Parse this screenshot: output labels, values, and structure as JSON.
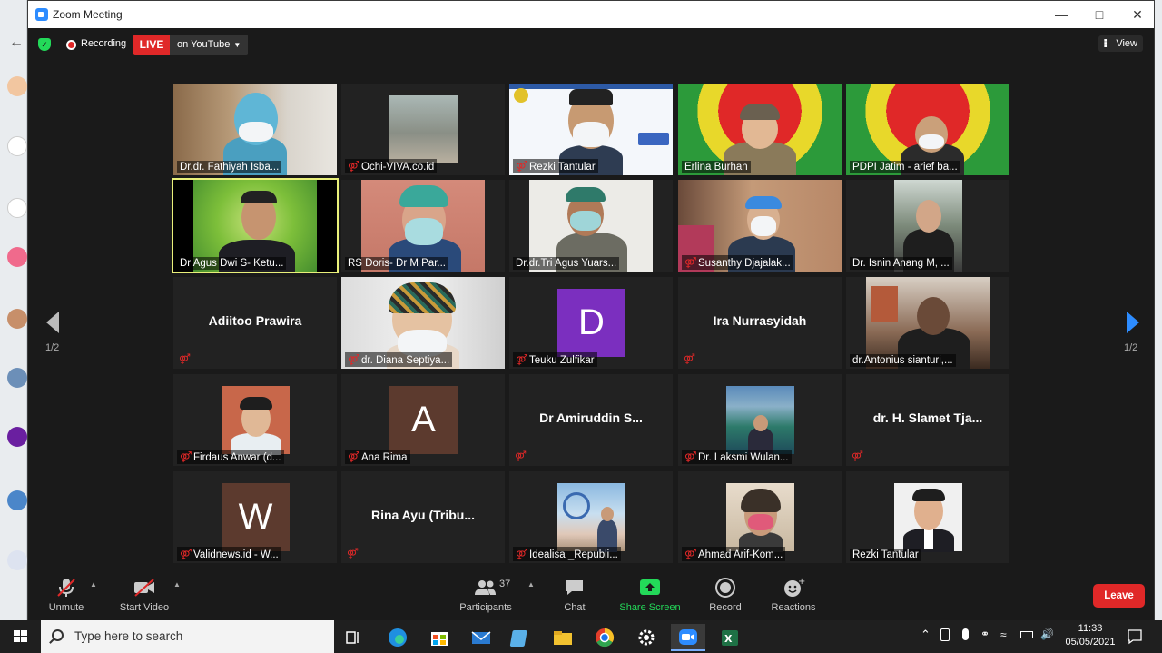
{
  "window": {
    "title": "Zoom Meeting"
  },
  "topbar": {
    "recording_label": "Recording",
    "live_label": "LIVE",
    "stream_target": "on YouTube",
    "view_label": "View"
  },
  "colors": {
    "accent": "#2d8cff",
    "live_red": "#e02828",
    "active_speaker": "#e9f07a",
    "share_green": "#23d959"
  },
  "pagination": {
    "current": "1/2"
  },
  "participants_grid": [
    [
      {
        "name": "Dr.dr. Fathiyah Isba...",
        "muted": false,
        "kind": "video"
      },
      {
        "name": "Ochi-VIVA.co.id",
        "muted": true,
        "kind": "video"
      },
      {
        "name": "Rezki Tantular",
        "muted": true,
        "kind": "video"
      },
      {
        "name": "Erlina Burhan",
        "muted": false,
        "kind": "video"
      },
      {
        "name": "PDPI Jatim - arief ba...",
        "muted": false,
        "kind": "video"
      }
    ],
    [
      {
        "name": "Dr Agus Dwi S- Ketu...",
        "muted": false,
        "kind": "video",
        "active": true
      },
      {
        "name": "RS Doris- Dr M Par...",
        "muted": false,
        "kind": "video"
      },
      {
        "name": "Dr.dr.Tri Agus Yuars...",
        "muted": false,
        "kind": "video"
      },
      {
        "name": "Susanthy Djajalak...",
        "muted": true,
        "kind": "video"
      },
      {
        "name": "Dr. Isnin Anang M, ...",
        "muted": false,
        "kind": "video"
      }
    ],
    [
      {
        "name": "Adiitoo Prawira",
        "muted": true,
        "kind": "nameonly"
      },
      {
        "name": "dr. Diana Septiya...",
        "muted": true,
        "kind": "video"
      },
      {
        "name": "Teuku Zulfikar",
        "muted": true,
        "kind": "avatar",
        "initial": "D",
        "avatar_color": "#7b2fbf"
      },
      {
        "name": "Ira Nurrasyidah",
        "muted": true,
        "kind": "nameonly"
      },
      {
        "name": "dr.Antonius sianturi,...",
        "muted": false,
        "kind": "video"
      }
    ],
    [
      {
        "name": "Firdaus Anwar (d...",
        "muted": true,
        "kind": "video"
      },
      {
        "name": "Ana Rima",
        "muted": true,
        "kind": "avatar",
        "initial": "A",
        "avatar_color": "#5c3a2e"
      },
      {
        "name": "Dr Amiruddin S...",
        "muted": true,
        "kind": "nameonly"
      },
      {
        "name": "Dr. Laksmi Wulan...",
        "muted": true,
        "kind": "video"
      },
      {
        "name": "dr. H. Slamet Tja...",
        "muted": true,
        "kind": "nameonly"
      }
    ],
    [
      {
        "name": "Validnews.id - W...",
        "muted": true,
        "kind": "avatar",
        "initial": "W",
        "avatar_color": "#5c3a2e"
      },
      {
        "name": "Rina Ayu (Tribu...",
        "muted": true,
        "kind": "nameonly"
      },
      {
        "name": "Idealisa _Republi...",
        "muted": true,
        "kind": "video"
      },
      {
        "name": "Ahmad Arif-Kom...",
        "muted": true,
        "kind": "video"
      },
      {
        "name": "Rezki Tantular",
        "muted": false,
        "kind": "video"
      }
    ]
  ],
  "toolbar": {
    "unmute": "Unmute",
    "start_video": "Start Video",
    "participants": "Participants",
    "participants_count": "37",
    "chat": "Chat",
    "share_screen": "Share Screen",
    "record": "Record",
    "reactions": "Reactions",
    "leave": "Leave"
  },
  "taskbar": {
    "search_placeholder": "Type here to search",
    "time": "11:33",
    "date": "05/05/2021"
  }
}
